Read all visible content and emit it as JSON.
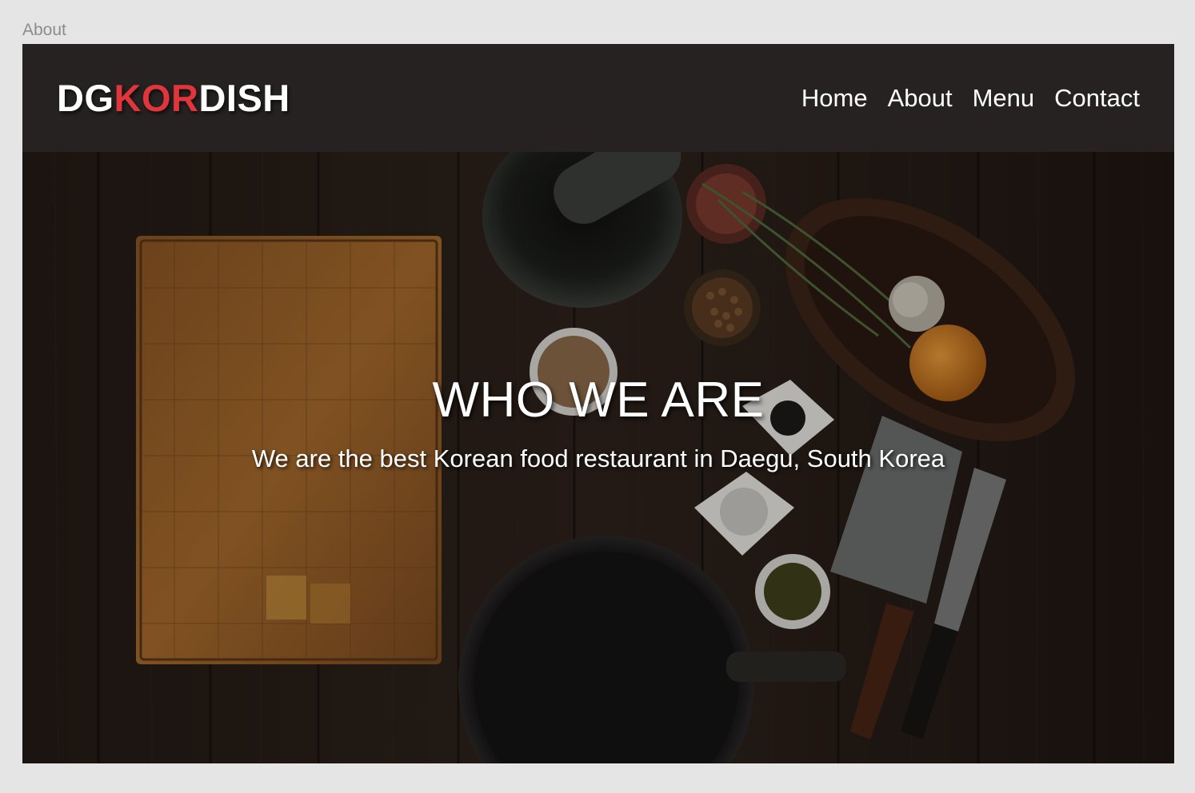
{
  "frame": {
    "label": "About"
  },
  "header": {
    "logo": {
      "part1": "DG",
      "part2": "KOR",
      "part3": "DISH"
    },
    "nav": [
      {
        "label": "Home"
      },
      {
        "label": "About"
      },
      {
        "label": "Menu"
      },
      {
        "label": "Contact"
      }
    ]
  },
  "hero": {
    "title": "WHO WE ARE",
    "subtitle": "We are the best Korean food restaurant in Daegu, South Korea"
  },
  "colors": {
    "background": "#e5e5e5",
    "navbar": "#262222",
    "logo_accent": "#e0353b",
    "text": "#ffffff"
  }
}
